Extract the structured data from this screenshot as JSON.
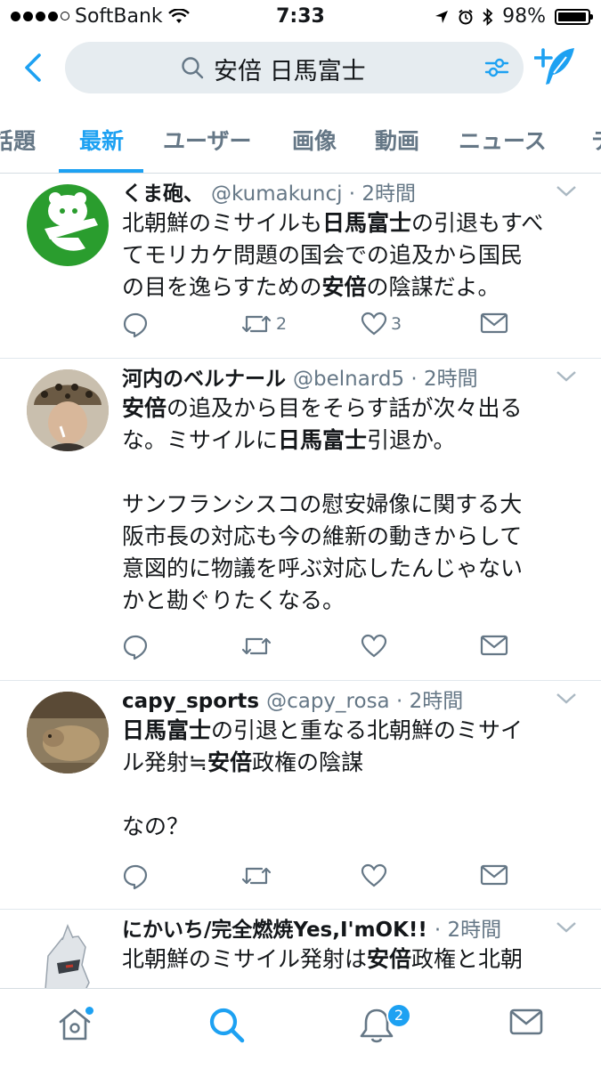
{
  "status_bar": {
    "carrier": "SoftBank",
    "time": "7:33",
    "battery_percent": "98%",
    "battery_level": 0.98
  },
  "search": {
    "query": "安倍 日馬富士"
  },
  "tabs": [
    {
      "label": "話題"
    },
    {
      "label": "最新"
    },
    {
      "label": "ユーザー"
    },
    {
      "label": "画像"
    },
    {
      "label": "動画"
    },
    {
      "label": "ニュース"
    },
    {
      "label": "テ"
    }
  ],
  "active_tab_index": 1,
  "tweets": [
    {
      "name": "くま砲、",
      "handle": "@kumakuncj · 2時間",
      "segments": [
        {
          "text": "北朝鮮のミサイルも",
          "bold": false
        },
        {
          "text": "日馬富士",
          "bold": true
        },
        {
          "text": "の引退もすべ\nてモリカケ問題の国会での追及から国民\nの目を逸らすための",
          "bold": false
        },
        {
          "text": "安倍",
          "bold": true
        },
        {
          "text": "の陰謀だよ。",
          "bold": false
        }
      ],
      "retweets": "2",
      "likes": "3"
    },
    {
      "name": "河内のベルナール",
      "handle": "@belnard5 · 2時間",
      "segments": [
        {
          "text": "安倍",
          "bold": true
        },
        {
          "text": "の追及から目をそらす話が次々出る\nな。ミサイルに",
          "bold": false
        },
        {
          "text": "日馬富士",
          "bold": true
        },
        {
          "text": "引退か。\n\nサンフランシスコの慰安婦像に関する大\n阪市長の対応も今の維新の動きからして\n意図的に物議を呼ぶ対応したんじゃない\nかと勘ぐりたくなる。",
          "bold": false
        }
      ],
      "retweets": "",
      "likes": ""
    },
    {
      "name": "capy_sports",
      "handle": "@capy_rosa · 2時間",
      "segments": [
        {
          "text": "日馬富士",
          "bold": true
        },
        {
          "text": "の引退と重なる北朝鮮のミサイ\nル発射≒",
          "bold": false
        },
        {
          "text": "安倍",
          "bold": true
        },
        {
          "text": "政権の陰謀\n\nなの？",
          "bold": false
        }
      ],
      "retweets": "",
      "likes": ""
    },
    {
      "name": "にかいち/完全燃焼Yes,I'mOK!!",
      "handle": "· 2時間",
      "segments": [
        {
          "text": "北朝鮮のミサイル発射は",
          "bold": false
        },
        {
          "text": "安倍",
          "bold": true
        },
        {
          "text": "政権と北朝",
          "bold": false
        }
      ],
      "retweets": "",
      "likes": ""
    }
  ],
  "bottom_nav": {
    "notifications_badge": "2"
  },
  "colors": {
    "accent": "#1da1f2",
    "muted": "#657786",
    "search_bg": "#e6ecf0"
  }
}
